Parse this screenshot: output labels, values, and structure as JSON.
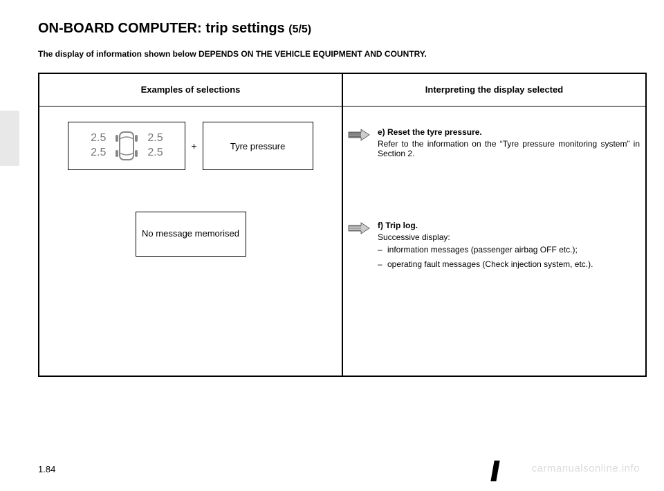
{
  "title_main": "ON-BOARD COMPUTER: trip settings",
  "title_sub": "(5/5)",
  "depends_note": "The display of information shown below DEPENDS ON THE VEHICLE EQUIPMENT AND COUNTRY.",
  "headers": {
    "examples": "Examples of selections",
    "interpreting": "Interpreting the display selected"
  },
  "tyre": {
    "values_left_top": "2.5",
    "values_left_bottom": "2.5",
    "values_right_top": "2.5",
    "values_right_bottom": "2.5",
    "plus": "+",
    "label": "Tyre pressure"
  },
  "no_message": "No message memorised",
  "item_e": {
    "label": "e)",
    "title": "Reset the tyre pressure.",
    "body": "Refer to the information on the “Tyre pressure monitoring system” in Section 2."
  },
  "item_f": {
    "label": "f)",
    "title": "Trip log.",
    "sub": "Successive display:",
    "bullet1": "information messages (passenger airbag OFF etc.);",
    "bullet2": "operating fault messages (Check injection system, etc.)."
  },
  "page_num": "1.84",
  "watermark": "carmanualsonline.info"
}
